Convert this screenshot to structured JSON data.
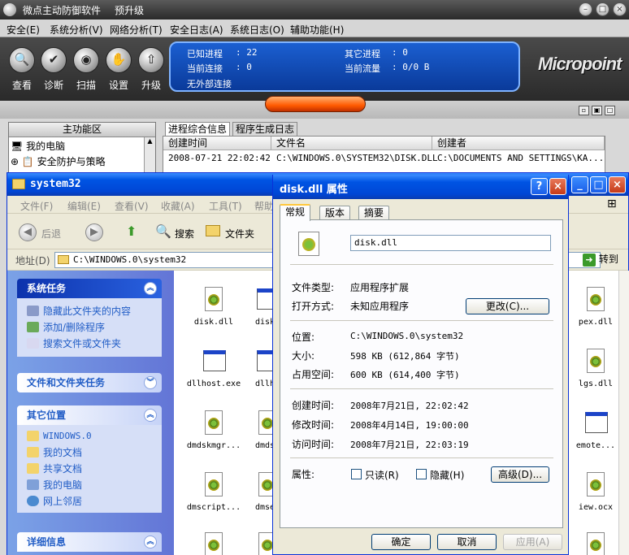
{
  "micropoint": {
    "title": "微点主动防御软件",
    "upgrade": "预升级",
    "menu": [
      "安全(E)",
      "系统分析(V)",
      "网络分析(T)",
      "安全日志(A)",
      "系统日志(O)",
      "辅助功能(H)"
    ],
    "tools": [
      {
        "label": "查看",
        "icon": "magnifier-icon"
      },
      {
        "label": "诊断",
        "icon": "shield-check-icon"
      },
      {
        "label": "扫描",
        "icon": "scan-icon"
      },
      {
        "label": "设置",
        "icon": "hand-settings-icon"
      },
      {
        "label": "升级",
        "icon": "upgrade-icon"
      }
    ],
    "status": {
      "known_process_label": "已知进程",
      "known_process_value": ": 22",
      "other_process_label": "其它进程",
      "other_process_value": ": 0",
      "connections_label": "当前连接",
      "connections_value": ": 0",
      "traffic_label": "当前流量",
      "traffic_value": ": 0/0 B",
      "external_conn": "无外部连接"
    },
    "brand": "Micropoint",
    "left_panel": {
      "header": "主功能区",
      "items": [
        "我的电脑",
        "安全防护与策略"
      ]
    },
    "tabs": [
      "进程综合信息",
      "程序生成日志"
    ],
    "grid": {
      "headers": [
        "创建时间",
        "文件名",
        "创建者"
      ],
      "row": [
        "2008-07-21 22:02:42",
        "C:\\WINDOWS.0\\SYSTEM32\\DISK.DLL",
        "C:\\DOCUMENTS AND SETTINGS\\KA..."
      ]
    }
  },
  "explorer": {
    "title": "system32",
    "menu": [
      "文件(F)",
      "编辑(E)",
      "查看(V)",
      "收藏(A)",
      "工具(T)",
      "帮助"
    ],
    "toolbar": {
      "back": "后退",
      "search": "搜索",
      "folders": "文件夹"
    },
    "address_label": "地址(D)",
    "address": "C:\\WINDOWS.0\\system32",
    "go": "转到",
    "side": {
      "system_tasks": {
        "title": "系统任务",
        "items": [
          "隐藏此文件夹的内容",
          "添加/删除程序",
          "搜索文件或文件夹"
        ]
      },
      "file_tasks": {
        "title": "文件和文件夹任务"
      },
      "other_places": {
        "title": "其它位置",
        "items": [
          "WINDOWS.0",
          "我的文档",
          "共享文档",
          "我的电脑",
          "网上邻居"
        ]
      },
      "details": {
        "title": "详细信息"
      }
    },
    "files": {
      "col1": [
        "disk.dll",
        "dllhost.exe",
        "dmdskmgr...",
        "dmscript...",
        ""
      ],
      "col2": [
        "diskc",
        "dllhs",
        "dmdsk",
        "dmser",
        ""
      ],
      "col3": [
        "pex.dll",
        "lgs.dll",
        "emote...",
        "iew.ocx",
        ""
      ]
    }
  },
  "dialog": {
    "title": "disk.dll 属性",
    "tabs": [
      "常规",
      "版本",
      "摘要"
    ],
    "file_name": "disk.dll",
    "rows": {
      "type_label": "文件类型:",
      "type_value": "应用程序扩展",
      "open_label": "打开方式:",
      "open_value": "未知应用程序",
      "change_btn": "更改(C)...",
      "location_label": "位置:",
      "location_value": "C:\\WINDOWS.0\\system32",
      "size_label": "大小:",
      "size_value": "598 KB (612,864 字节)",
      "disk_label": "占用空间:",
      "disk_value": "600 KB (614,400 字节)",
      "created_label": "创建时间:",
      "created_value": "2008年7月21日, 22:02:42",
      "modified_label": "修改时间:",
      "modified_value": "2008年4月14日, 19:00:00",
      "accessed_label": "访问时间:",
      "accessed_value": "2008年7月21日, 22:03:19",
      "attr_label": "属性:",
      "readonly": "只读(R)",
      "hidden": "隐藏(H)",
      "advanced": "高级(D)..."
    },
    "buttons": {
      "ok": "确定",
      "cancel": "取消",
      "apply": "应用(A)"
    }
  }
}
